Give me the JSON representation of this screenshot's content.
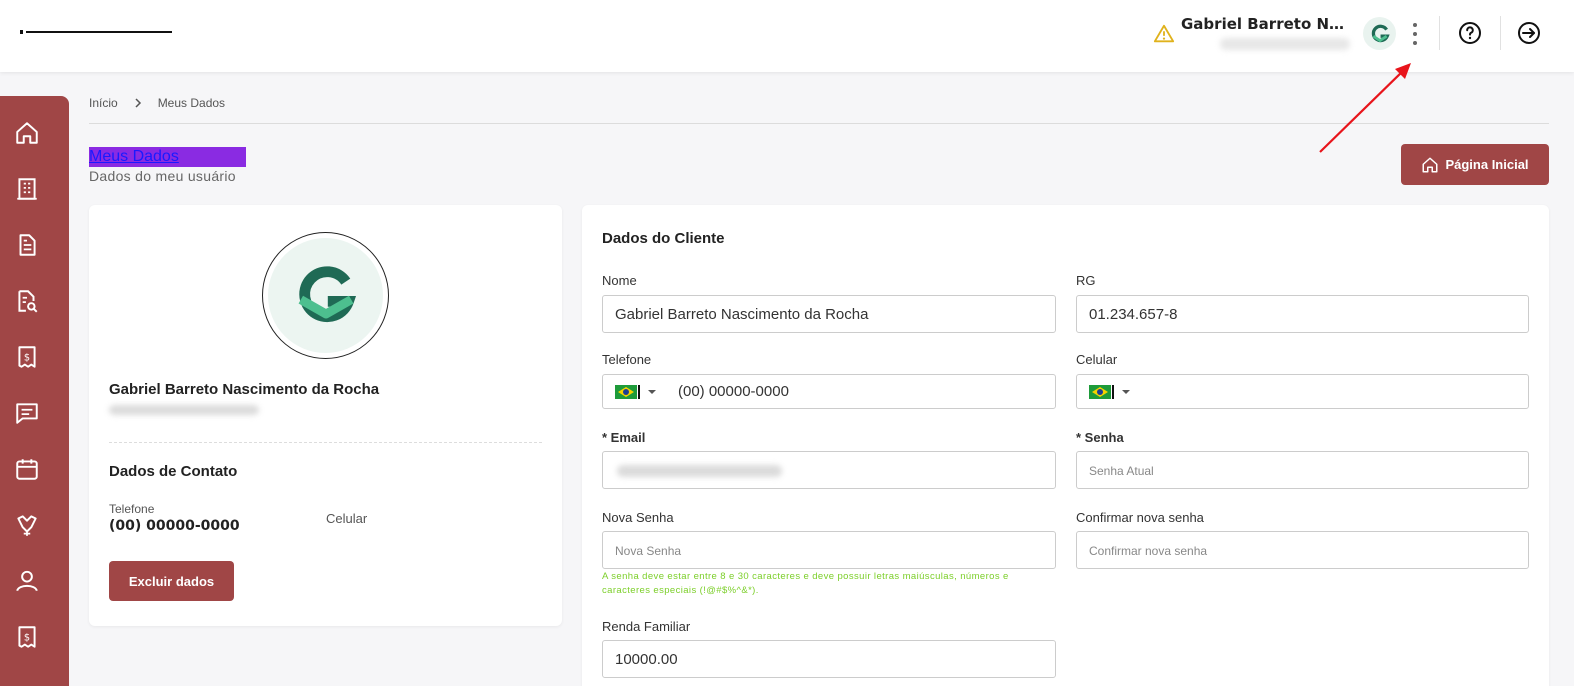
{
  "header": {
    "user_name": "Gabriel Barreto Nascimento da Rocha",
    "avatar_letter": "G"
  },
  "sidebar": {
    "items": [
      {
        "icon": "home-icon"
      },
      {
        "icon": "building-icon"
      },
      {
        "icon": "document-icon"
      },
      {
        "icon": "document-search-icon"
      },
      {
        "icon": "receipt-dollar-icon"
      },
      {
        "icon": "message-icon"
      },
      {
        "icon": "calendar-icon"
      },
      {
        "icon": "handshake-icon"
      },
      {
        "icon": "user-icon"
      },
      {
        "icon": "receipt-dollar-icon"
      }
    ],
    "color": "#a04646"
  },
  "breadcrumb": {
    "home": "Início",
    "current": "Meus Dados"
  },
  "page": {
    "title": "Meus Dados",
    "subtitle": "Dados do meu usuário",
    "home_button": "Página Inicial"
  },
  "profile_card": {
    "name": "Gabriel Barreto Nascimento da Rocha",
    "contact_title": "Dados de Contato",
    "phone_label": "Telefone",
    "phone_value": "(00) 00000-0000",
    "cell_label": "Celular",
    "delete_button": "Excluir dados"
  },
  "client_form": {
    "section_title": "Dados do Cliente",
    "nome_label": "Nome",
    "nome_value": "Gabriel Barreto Nascimento da Rocha",
    "rg_label": "RG",
    "rg_value": "01.234.657-8",
    "telefone_label": "Telefone",
    "telefone_value": "(00) 00000-0000",
    "celular_label": "Celular",
    "celular_value": "",
    "email_label": "* Email",
    "senha_label": "* Senha",
    "senha_placeholder": "Senha Atual",
    "nova_senha_label": "Nova Senha",
    "nova_senha_placeholder": "Nova Senha",
    "confirmar_label": "Confirmar nova senha",
    "confirmar_placeholder": "Confirmar nova senha",
    "password_hint": "A senha deve estar entre 8 e 30 caracteres e deve possuir letras maiúsculas, números e caracteres especiais (!@#$%^&*).",
    "renda_label": "Renda Familiar",
    "renda_value": "10000.00"
  },
  "colors": {
    "brand": "#a04646",
    "hint": "#7ccf2a",
    "annotation": "#e8141b"
  }
}
